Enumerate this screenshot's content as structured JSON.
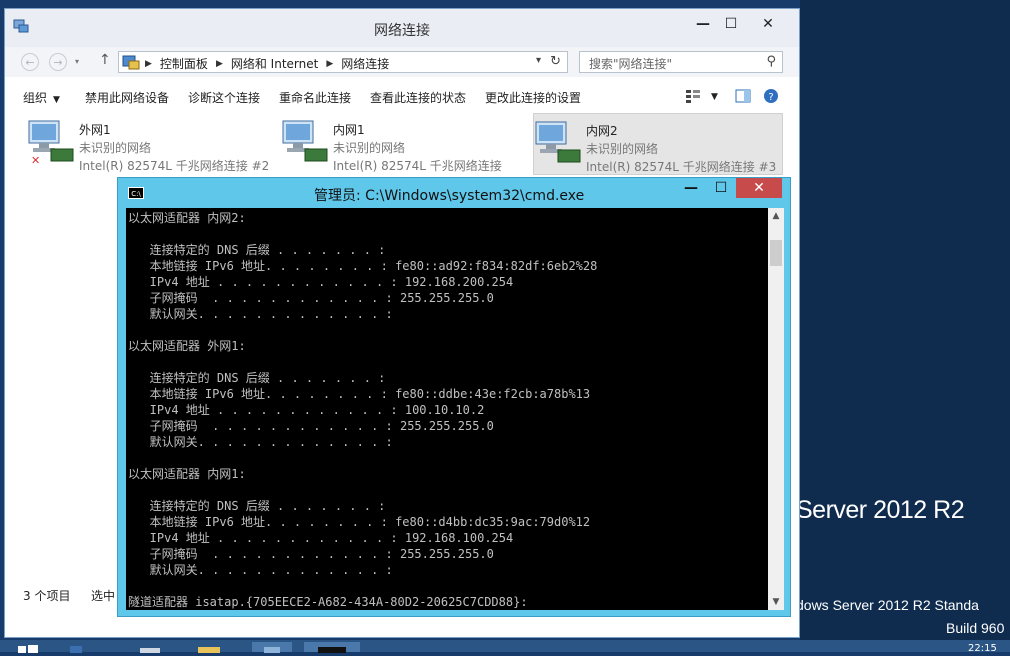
{
  "desktop": {
    "watermark_product": "Server 2012 R2",
    "watermark_edition": "dows Server 2012 R2 Standa",
    "watermark_build": "Build 960",
    "clock": "22:15"
  },
  "explorer": {
    "title": "网络连接",
    "caption": {
      "minimize": "—",
      "maximize": "☐",
      "close": "✕"
    },
    "breadcrumb": [
      "控制面板",
      "网络和 Internet",
      "网络连接"
    ],
    "search_placeholder": "搜索\"网络连接\"",
    "commands": [
      "组织",
      "禁用此网络设备",
      "诊断这个连接",
      "重命名此连接",
      "查看此连接的状态",
      "更改此连接的设置"
    ],
    "adapters": [
      {
        "name": "外网1",
        "status": "未识别的网络",
        "device": "Intel(R) 82574L 千兆网络连接 #2"
      },
      {
        "name": "内网1",
        "status": "未识别的网络",
        "device": "Intel(R) 82574L 千兆网络连接"
      },
      {
        "name": "内网2",
        "status": "未识别的网络",
        "device": "Intel(R) 82574L 千兆网络连接 #3"
      }
    ],
    "status_count": "3 个项目",
    "status_selected": "选中"
  },
  "cmd": {
    "title": "管理员: C:\\Windows\\system32\\cmd.exe",
    "icon_text": "C:\\",
    "lines": [
      "以太网适配器 内网2:",
      "",
      "   连接特定的 DNS 后缀 . . . . . . . :",
      "   本地链接 IPv6 地址. . . . . . . . : fe80::ad92:f834:82df:6eb2%28",
      "   IPv4 地址 . . . . . . . . . . . . : 192.168.200.254",
      "   子网掩码  . . . . . . . . . . . . : 255.255.255.0",
      "   默认网关. . . . . . . . . . . . . :",
      "",
      "以太网适配器 外网1:",
      "",
      "   连接特定的 DNS 后缀 . . . . . . . :",
      "   本地链接 IPv6 地址. . . . . . . . : fe80::ddbe:43e:f2cb:a78b%13",
      "   IPv4 地址 . . . . . . . . . . . . : 100.10.10.2",
      "   子网掩码  . . . . . . . . . . . . : 255.255.255.0",
      "   默认网关. . . . . . . . . . . . . :",
      "",
      "以太网适配器 内网1:",
      "",
      "   连接特定的 DNS 后缀 . . . . . . . :",
      "   本地链接 IPv6 地址. . . . . . . . : fe80::d4bb:dc35:9ac:79d0%12",
      "   IPv4 地址 . . . . . . . . . . . . : 192.168.100.254",
      "   子网掩码  . . . . . . . . . . . . : 255.255.255.0",
      "   默认网关. . . . . . . . . . . . . :",
      "",
      "隧道适配器 isatap.{705EECE2-A682-434A-80D2-20625C7CDD88}:"
    ]
  },
  "colors": {
    "cmd_frame": "#5fc7ea",
    "console_bg": "#000000",
    "console_text": "#c0c0c0",
    "close_red": "#c74b4b"
  }
}
